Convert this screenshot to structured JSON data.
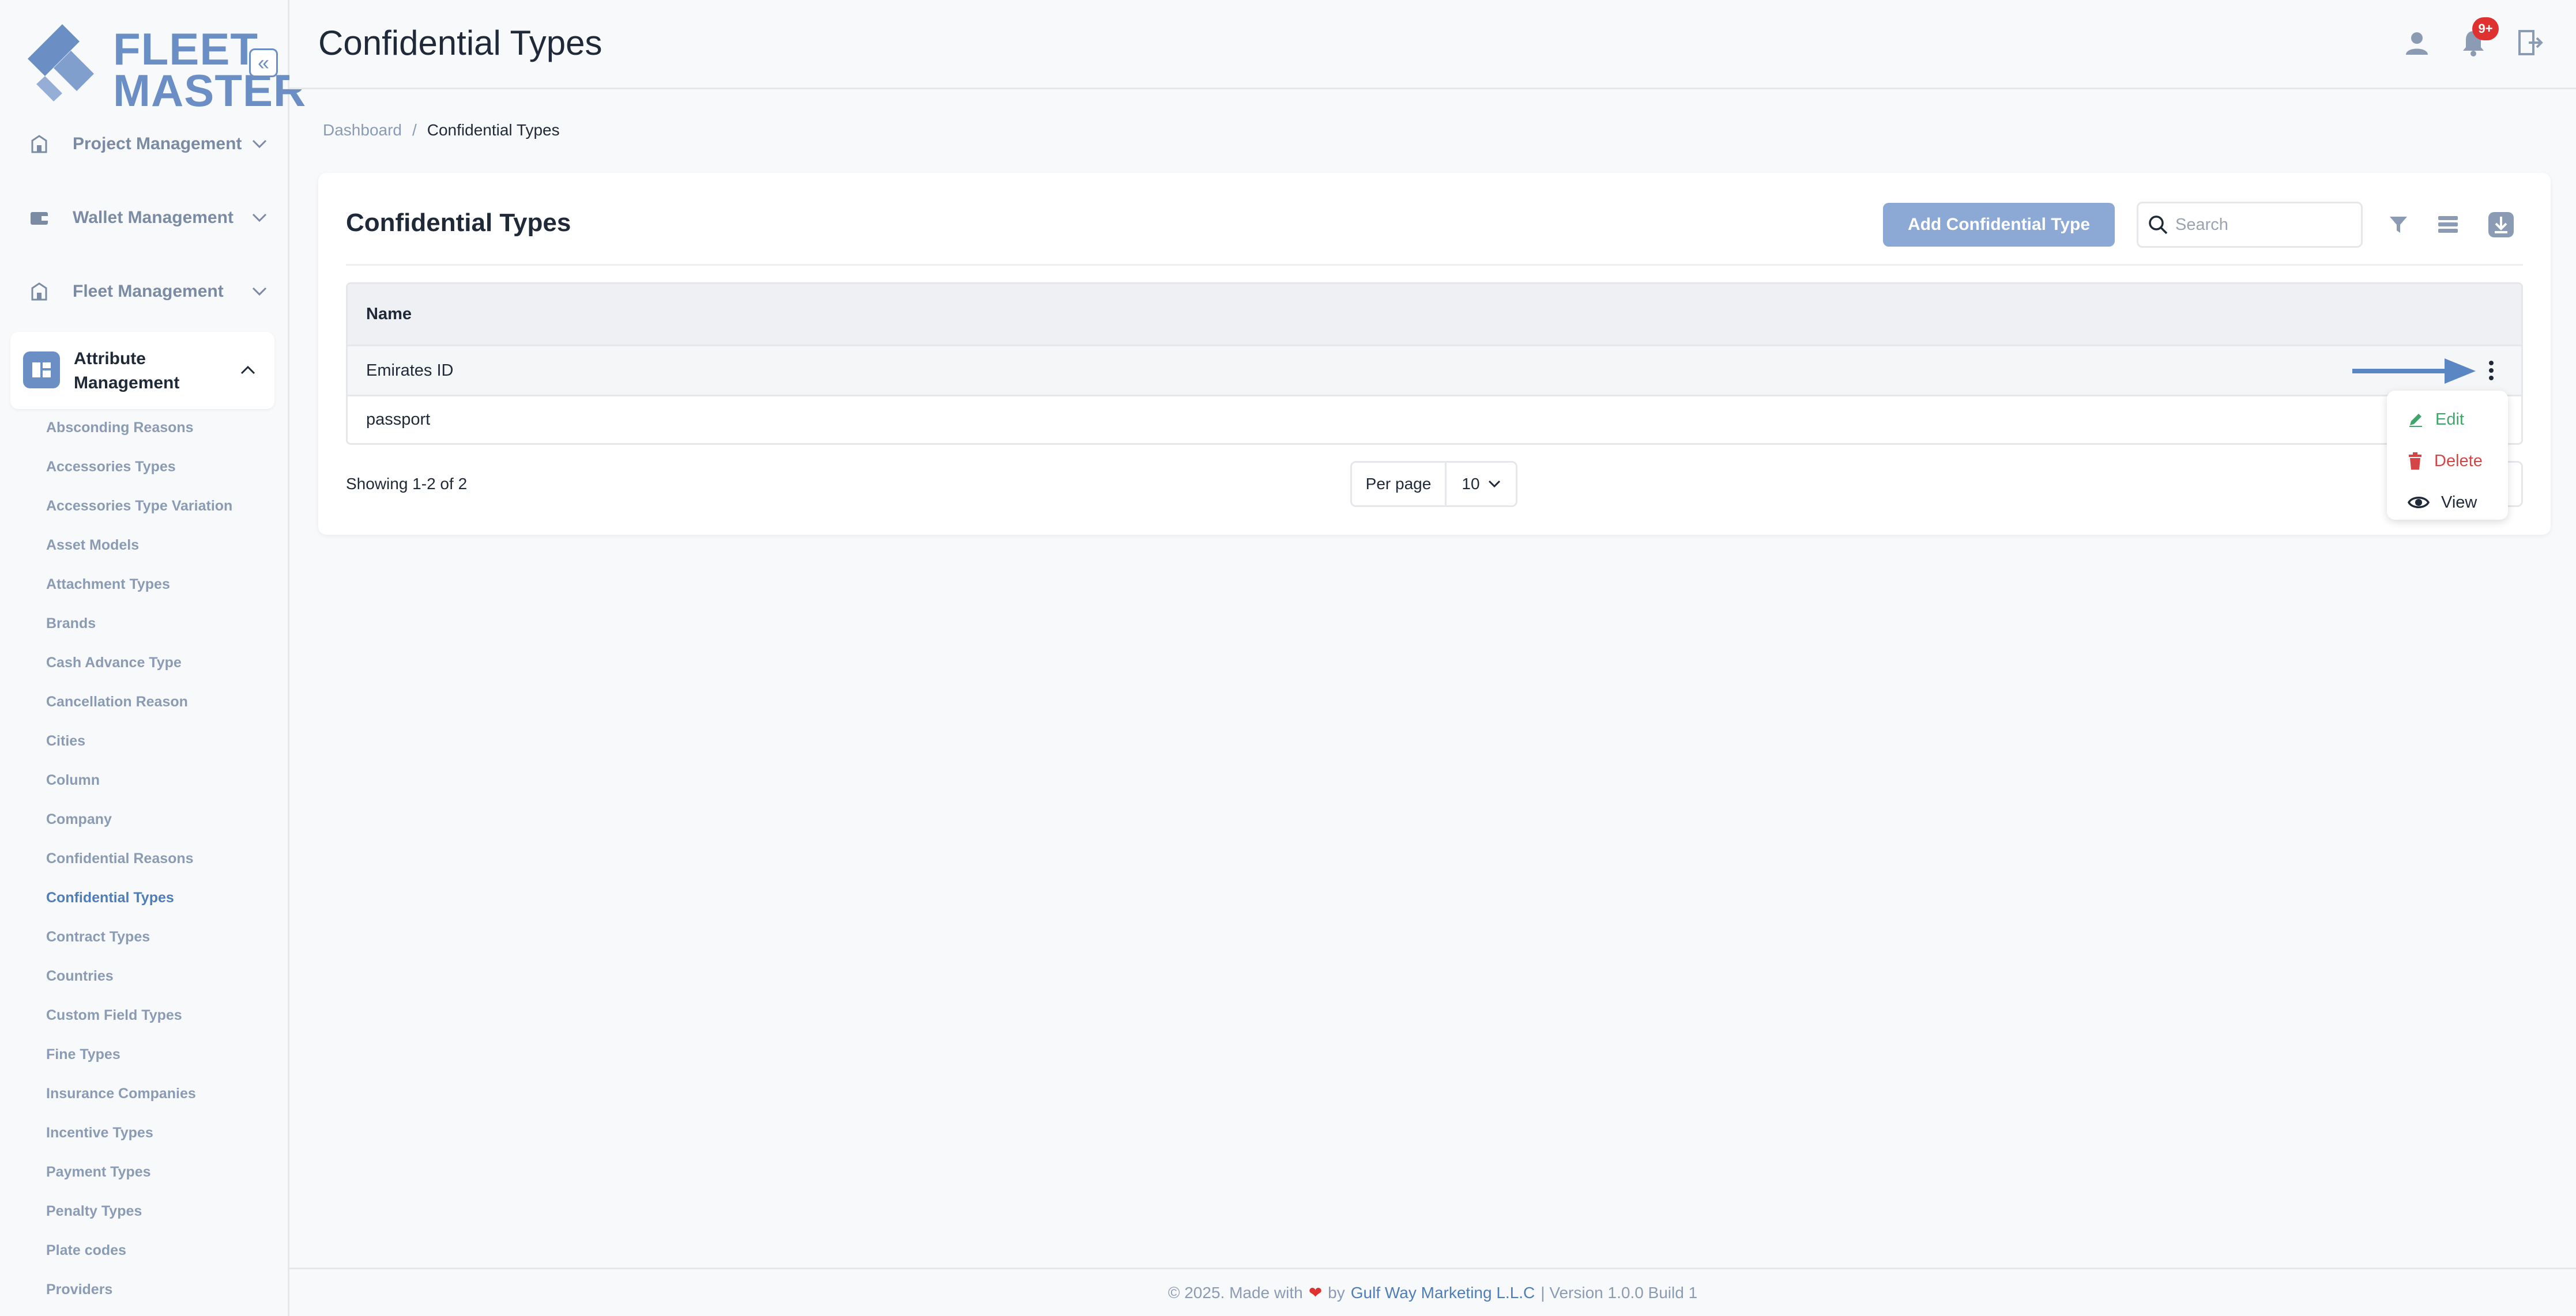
{
  "app": {
    "logo_line1": "FLEET",
    "logo_line2": "MASTER",
    "collapse_glyph": "«"
  },
  "sidebar": {
    "groups": [
      {
        "label": "Project Management",
        "icon": "building-icon"
      },
      {
        "label": "Wallet Management",
        "icon": "wallet-icon"
      },
      {
        "label": "Fleet Management",
        "icon": "fleet-icon"
      }
    ],
    "active_group": {
      "label_line1": "Attribute",
      "label_line2": "Management",
      "icon": "attributes-icon"
    },
    "sub_items": [
      "Absconding Reasons",
      "Accessories Types",
      "Accessories Type Variation",
      "Asset Models",
      "Attachment Types",
      "Brands",
      "Cash Advance Type",
      "Cancellation Reason",
      "Cities",
      "Column",
      "Company",
      "Confidential Reasons",
      "Confidential Types",
      "Contract Types",
      "Countries",
      "Custom Field Types",
      "Fine Types",
      "Insurance Companies",
      "Incentive Types",
      "Payment Types",
      "Penalty Types",
      "Plate codes",
      "Providers"
    ],
    "active_sub_item": "Confidential Types"
  },
  "header": {
    "title": "Confidential Types",
    "notification_count": "9+"
  },
  "breadcrumb": {
    "home": "Dashboard",
    "separator": "/",
    "current": "Confidential Types"
  },
  "card": {
    "title": "Confidential Types",
    "add_button": "Add Confidential Type",
    "search_placeholder": "Search"
  },
  "table": {
    "columns": [
      "Name"
    ],
    "rows": [
      {
        "name": "Emirates ID"
      },
      {
        "name": "passport"
      }
    ]
  },
  "pagination": {
    "showing": "Showing 1-2 of 2",
    "per_page_label": "Per page",
    "per_page_value": "10"
  },
  "row_menu": {
    "items": [
      "Edit",
      "Delete",
      "View"
    ]
  },
  "footer": {
    "prefix": "© 2025. Made with",
    "heart": "❤",
    "by": "by",
    "company": "Gulf Way Marketing L.L.C",
    "version": "| Version 1.0.0 Build 1"
  },
  "colors": {
    "brand": "#6b8fc4",
    "accent_link": "#4f7db8",
    "edit": "#3fa66a",
    "delete": "#d64545",
    "badge": "#e03131"
  }
}
